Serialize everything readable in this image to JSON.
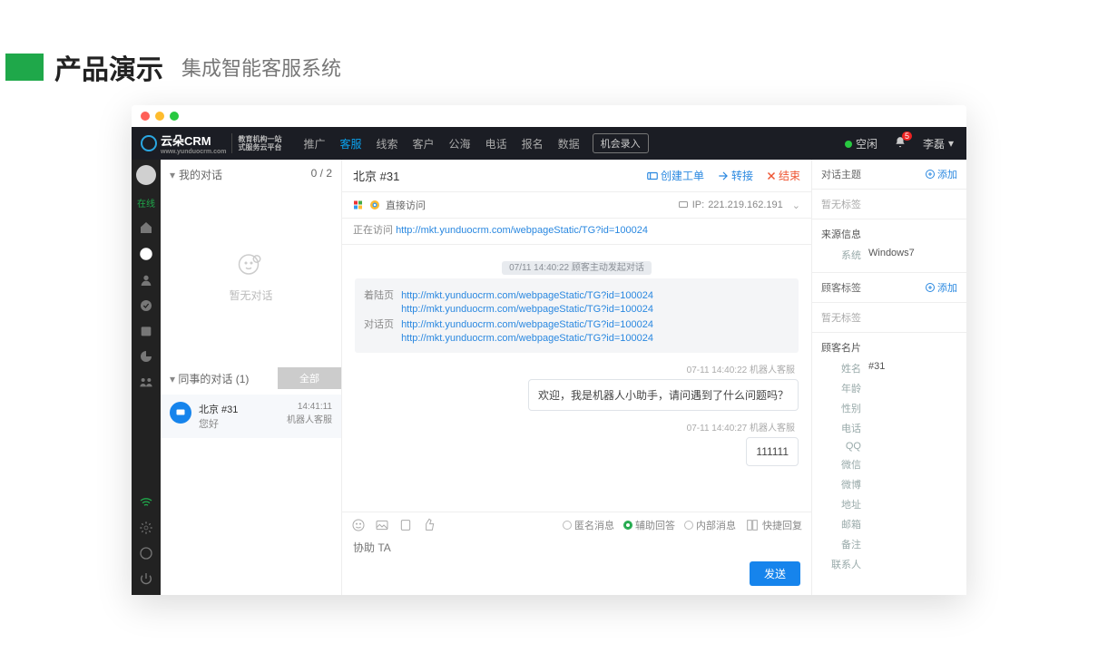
{
  "slide": {
    "title": "产品演示",
    "subtitle": "集成智能客服系统"
  },
  "brand": {
    "name": "云朵CRM",
    "desc1": "教育机构一站",
    "desc2": "式服务云平台",
    "site": "www.yunduocrm.com"
  },
  "nav": {
    "items": [
      "推广",
      "客服",
      "线索",
      "客户",
      "公海",
      "电话",
      "报名",
      "数据"
    ],
    "active": "客服",
    "record_btn": "机会录入",
    "status": "空闲",
    "badge": "5",
    "user": "李磊"
  },
  "rail": {
    "online": "在线"
  },
  "convpanel": {
    "myconv": "我的对话",
    "count": "0 / 2",
    "empty": "暂无对话",
    "colleague": "同事的对话  (1)",
    "all_btn": "全部",
    "item": {
      "title": "北京 #31",
      "sub": "您好",
      "time": "14:41:11",
      "agent": "机器人客服"
    }
  },
  "chat": {
    "title": "北京 #31",
    "actions": {
      "ticket": "创建工单",
      "transfer": "转接",
      "end": "结束"
    },
    "visit": {
      "label": "直接访问",
      "ip_label": "IP:",
      "ip": "221.219.162.191",
      "visiting_label": "正在访问",
      "visiting_url": "http://mkt.yunduocrm.com/webpageStatic/TG?id=100024"
    },
    "syspill": "07/11 14:40:22  顾客主动发起对话",
    "urlcard": {
      "land_label": "着陆页",
      "talk_label": "对话页",
      "urls": [
        "http://mkt.yunduocrm.com/webpageStatic/TG?id=100024",
        "http://mkt.yunduocrm.com/webpageStatic/TG?id=100024",
        "http://mkt.yunduocrm.com/webpageStatic/TG?id=100024",
        "http://mkt.yunduocrm.com/webpageStatic/TG?id=100024"
      ]
    },
    "msgs": [
      {
        "meta": "07-11 14:40:22  机器人客服",
        "text": "欢迎，我是机器人小助手，请问遇到了什么问题吗？"
      },
      {
        "meta": "07-11 14:40:27  机器人客服",
        "text": "111111"
      }
    ],
    "composer": {
      "anon": "匿名消息",
      "assist": "辅助回答",
      "internal": "内部消息",
      "quick": "快捷回复",
      "placeholder": "协助 TA",
      "send": "发送"
    }
  },
  "side": {
    "topic_title": "对话主题",
    "add": "添加",
    "no_tag": "暂无标签",
    "source_title": "来源信息",
    "system_label": "系统",
    "system_value": "Windows7",
    "tags_title": "顾客标签",
    "card_title": "顾客名片",
    "card": {
      "name_label": "姓名",
      "name_value": "#31",
      "age_label": "年龄",
      "gender_label": "性别",
      "phone_label": "电话",
      "qq_label": "QQ",
      "wechat_label": "微信",
      "weibo_label": "微博",
      "addr_label": "地址",
      "email_label": "邮箱",
      "remark_label": "备注",
      "contact_label": "联系人"
    }
  }
}
